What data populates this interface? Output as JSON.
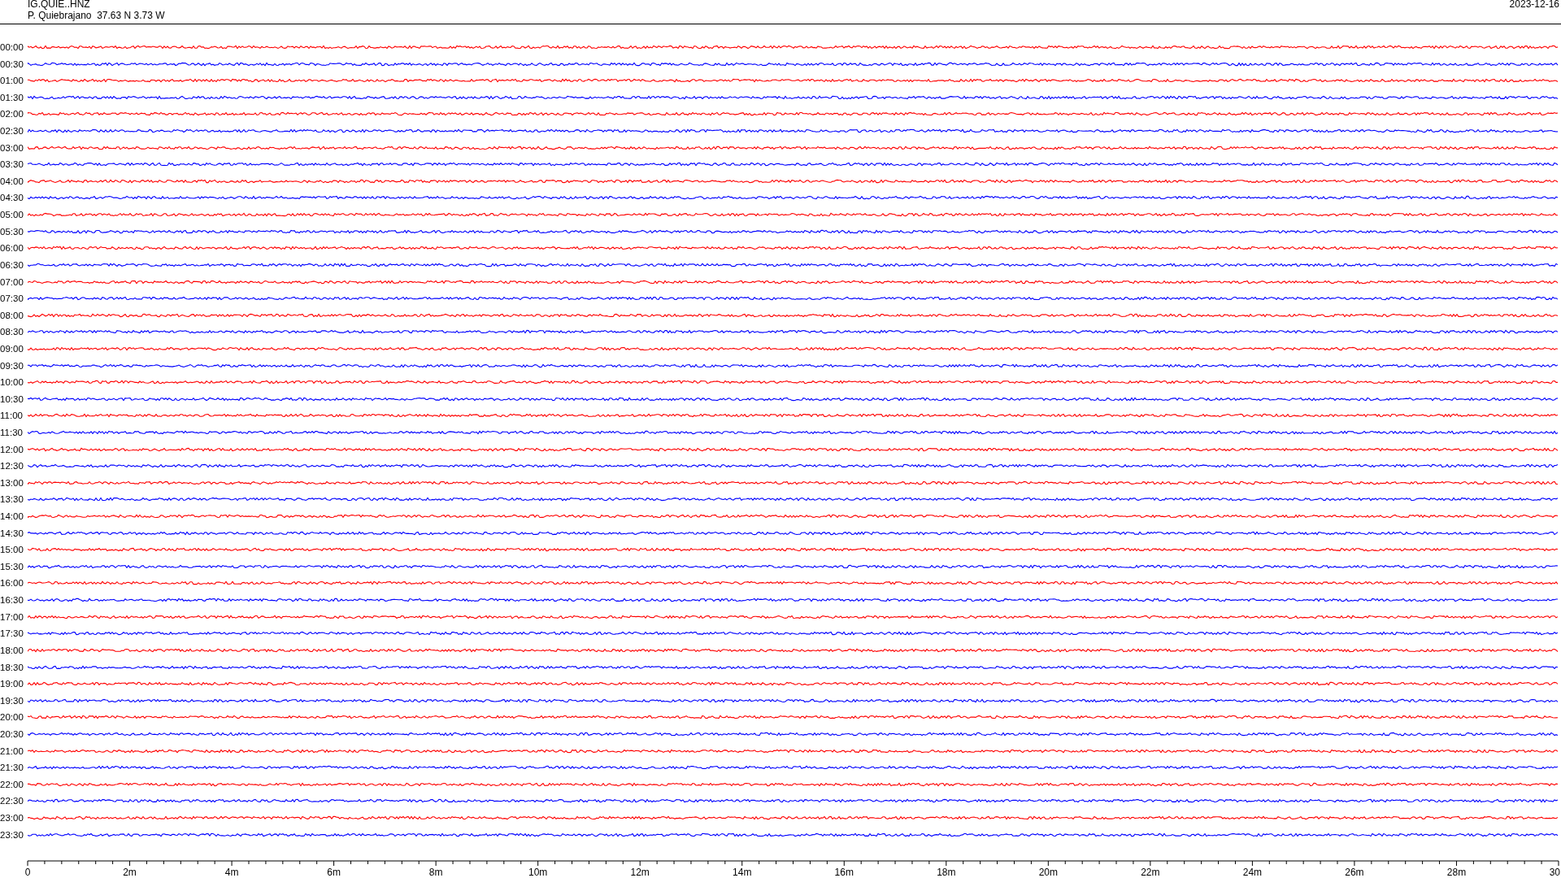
{
  "header": {
    "station": "IG.QUIE..HNZ",
    "location": "P. Quiebrajano  37.63 N 3.73 W",
    "date": "2023-12-16"
  },
  "traces": [
    {
      "label": "00:00",
      "color": "#ff0000"
    },
    {
      "label": "00:30",
      "color": "#0000ff"
    },
    {
      "label": "01:00",
      "color": "#ff0000"
    },
    {
      "label": "01:30",
      "color": "#0000ff"
    },
    {
      "label": "02:00",
      "color": "#ff0000"
    },
    {
      "label": "02:30",
      "color": "#0000ff"
    },
    {
      "label": "03:00",
      "color": "#ff0000"
    },
    {
      "label": "03:30",
      "color": "#0000ff"
    },
    {
      "label": "04:00",
      "color": "#ff0000"
    },
    {
      "label": "04:30",
      "color": "#0000ff"
    },
    {
      "label": "05:00",
      "color": "#ff0000"
    },
    {
      "label": "05:30",
      "color": "#0000ff"
    },
    {
      "label": "06:00",
      "color": "#ff0000"
    },
    {
      "label": "06:30",
      "color": "#0000ff"
    },
    {
      "label": "07:00",
      "color": "#ff0000"
    },
    {
      "label": "07:30",
      "color": "#0000ff"
    },
    {
      "label": "08:00",
      "color": "#ff0000"
    },
    {
      "label": "08:30",
      "color": "#0000ff"
    },
    {
      "label": "09:00",
      "color": "#ff0000"
    },
    {
      "label": "09:30",
      "color": "#0000ff"
    },
    {
      "label": "10:00",
      "color": "#ff0000"
    },
    {
      "label": "10:30",
      "color": "#0000ff"
    },
    {
      "label": "11:00",
      "color": "#ff0000"
    },
    {
      "label": "11:30",
      "color": "#0000ff"
    },
    {
      "label": "12:00",
      "color": "#ff0000"
    },
    {
      "label": "12:30",
      "color": "#0000ff"
    },
    {
      "label": "13:00",
      "color": "#ff0000"
    },
    {
      "label": "13:30",
      "color": "#0000ff"
    },
    {
      "label": "14:00",
      "color": "#ff0000"
    },
    {
      "label": "14:30",
      "color": "#0000ff"
    },
    {
      "label": "15:00",
      "color": "#ff0000"
    },
    {
      "label": "15:30",
      "color": "#0000ff"
    },
    {
      "label": "16:00",
      "color": "#ff0000"
    },
    {
      "label": "16:30",
      "color": "#0000ff"
    },
    {
      "label": "17:00",
      "color": "#ff0000"
    },
    {
      "label": "17:30",
      "color": "#0000ff"
    },
    {
      "label": "18:00",
      "color": "#ff0000"
    },
    {
      "label": "18:30",
      "color": "#0000ff"
    },
    {
      "label": "19:00",
      "color": "#ff0000"
    },
    {
      "label": "19:30",
      "color": "#0000ff"
    },
    {
      "label": "20:00",
      "color": "#ff0000"
    },
    {
      "label": "20:30",
      "color": "#0000ff"
    },
    {
      "label": "21:00",
      "color": "#ff0000"
    },
    {
      "label": "21:30",
      "color": "#0000ff"
    },
    {
      "label": "22:00",
      "color": "#ff0000"
    },
    {
      "label": "22:30",
      "color": "#0000ff"
    },
    {
      "label": "23:00",
      "color": "#ff0000"
    },
    {
      "label": "23:30",
      "color": "#0000ff"
    }
  ],
  "time_axis": {
    "labels": [
      "0",
      "2m",
      "4m",
      "6m",
      "8m",
      "10m",
      "12m",
      "14m",
      "16m",
      "18m",
      "20m",
      "22m",
      "24m",
      "26m",
      "28m",
      "30"
    ]
  }
}
